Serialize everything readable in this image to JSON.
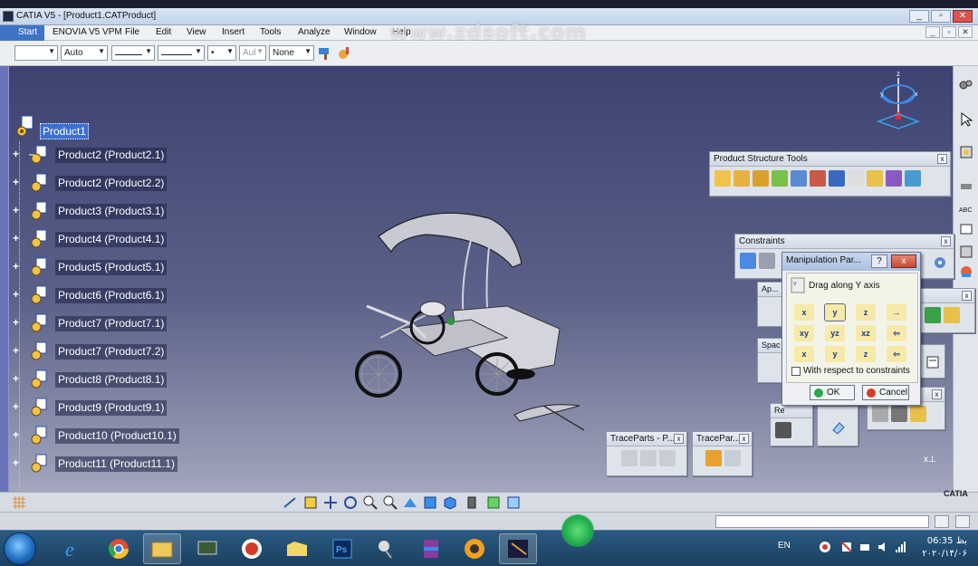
{
  "window": {
    "title": "CATIA V5 - [Product1.CATProduct]",
    "buttons": [
      "_",
      "▫",
      "✕"
    ],
    "mdi_buttons": [
      "_",
      "▫",
      "✕"
    ]
  },
  "watermark": "www.zdsoft.com",
  "menubar": {
    "items": [
      "Start",
      "ENOVIA V5 VPM",
      "File",
      "Edit",
      "View",
      "Insert",
      "Tools",
      "Analyze",
      "Window",
      "Help"
    ]
  },
  "graphic_toolbar": {
    "color_value": "",
    "transparency_value": "Auto",
    "layer_value": "Aul",
    "filter_value": "None"
  },
  "tree": {
    "root": "Product1",
    "items": [
      "Product2 (Product2.1)",
      "Product2 (Product2.2)",
      "Product3 (Product3.1)",
      "Product4 (Product4.1)",
      "Product5 (Product5.1)",
      "Product6 (Product6.1)",
      "Product7 (Product7.1)",
      "Product7 (Product7.2)",
      "Product8 (Product8.1)",
      "Product9 (Product9.1)",
      "Product10 (Product10.1)",
      "Product11 (Product11.1)"
    ]
  },
  "toolbars": {
    "product_structure": "Product Structure Tools",
    "constraints": "Constraints",
    "ap": "Ap...",
    "spac": "Spac",
    "re": "Re",
    "traceparts_1": "TraceParts - P...",
    "traceparts_2": "TracePar..."
  },
  "dialog": {
    "title": "Manipulation Par...",
    "help": "?",
    "close": "x",
    "hint": "Drag along Y axis",
    "grid_labels": [
      "x",
      "y",
      "z",
      "→",
      "xy",
      "yz",
      "xz",
      "⇦",
      "x",
      "y",
      "z",
      "⇦"
    ],
    "checkbox_label": "With respect to constraints",
    "checkbox_checked": false,
    "ok": "OK",
    "cancel": "Cancel"
  },
  "axis_label": "x",
  "catia_logo": "CATIA",
  "taskbar": {
    "language": "EN",
    "time": "بظ 06:35",
    "date": "۲۰۲۰/۱۴/۰۶"
  }
}
